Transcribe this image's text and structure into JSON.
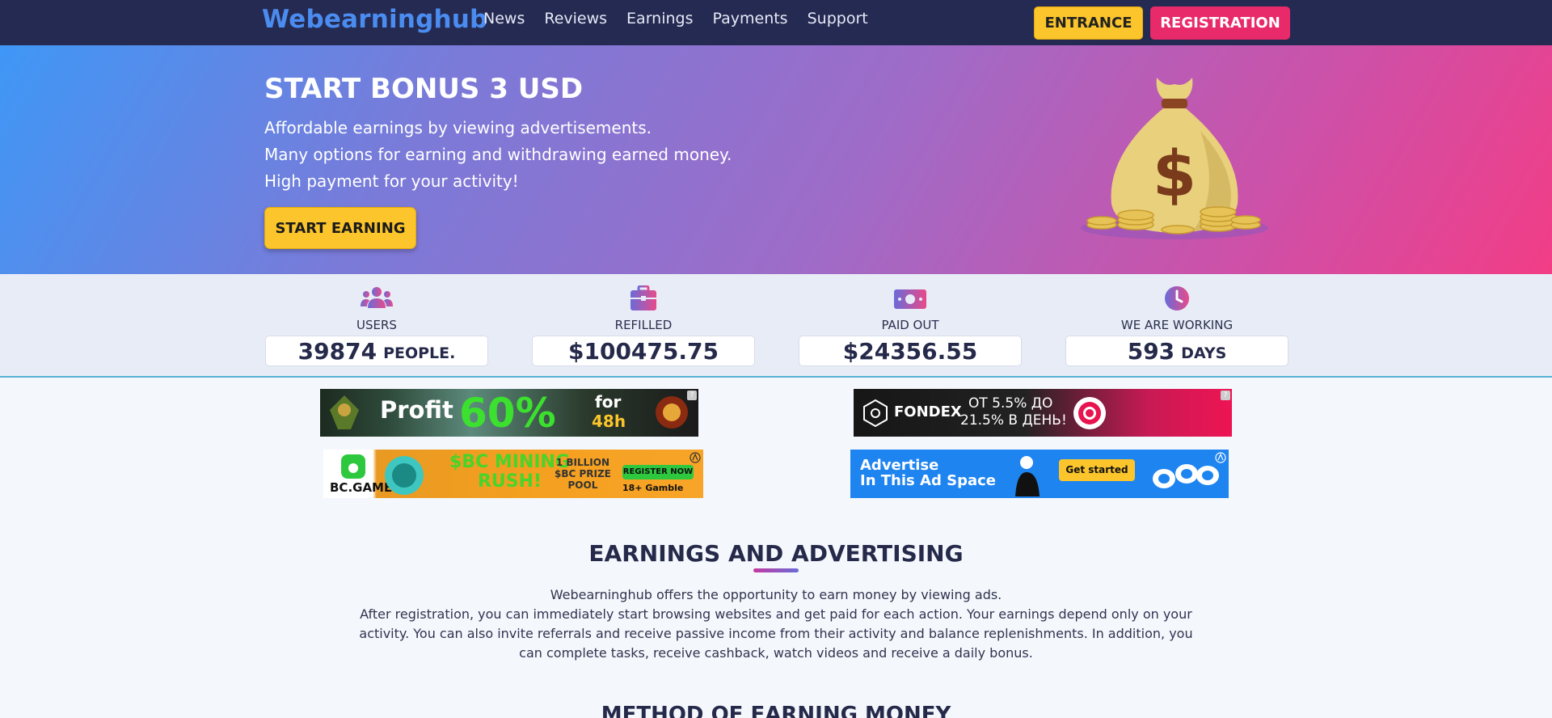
{
  "nav": {
    "logo": "Webearninghub",
    "links": [
      "News",
      "Reviews",
      "Earnings",
      "Payments",
      "Support"
    ],
    "entrance": "ENTRANCE",
    "registration": "REGISTRATION"
  },
  "hero": {
    "title": "START BONUS 3 USD",
    "lines": [
      "Affordable earnings by viewing advertisements.",
      "Many options for earning and withdrawing earned money.",
      "High payment for your activity!"
    ],
    "cta": "START EARNING",
    "bag_symbol": "$"
  },
  "stats": [
    {
      "label": "USERS",
      "value": "39874",
      "unit": "PEOPLE.",
      "icon": "users-icon"
    },
    {
      "label": "REFILLED",
      "value": "$100475.75",
      "unit": "",
      "icon": "briefcase-icon"
    },
    {
      "label": "PAID OUT",
      "value": "$24356.55",
      "unit": "",
      "icon": "banknote-icon"
    },
    {
      "label": "WE ARE WORKING",
      "value": "593",
      "unit": "DAYS",
      "icon": "clock-icon"
    }
  ],
  "ads": {
    "ad1": {
      "a": "Profit",
      "b": "60%",
      "c": "for",
      "d": "48h"
    },
    "ad2": {
      "logo": "FONDEX",
      "t1": "ОТ 5.5% ДО",
      "t2": "21.5% В ДЕНЬ!"
    },
    "ad3": {
      "logo": "BC.GAME",
      "main1": "$BC MINING",
      "main2": "RUSH!",
      "prize1": "1 BILLION",
      "prize2": "$BC PRIZE",
      "prize3": "POOL",
      "register": "REGISTER NOW",
      "age": "18+ Gamble"
    },
    "ad4": {
      "line1": "Advertise",
      "line2": "In This Ad Space",
      "button": "Get started"
    },
    "help": "?"
  },
  "section": {
    "title": "EARNINGS AND ADVERTISING",
    "text1": "Webearninghub offers the opportunity to earn money by viewing ads.",
    "text2": "After registration, you can immediately start browsing websites and get paid for each action. Your earnings depend only on your activity. You can also invite referrals and receive passive income from their activity and balance replenishments. In addition, you can complete tasks, receive cashback, watch videos and receive a daily bonus.",
    "next_title": "METHOD OF EARNING MONEY"
  }
}
